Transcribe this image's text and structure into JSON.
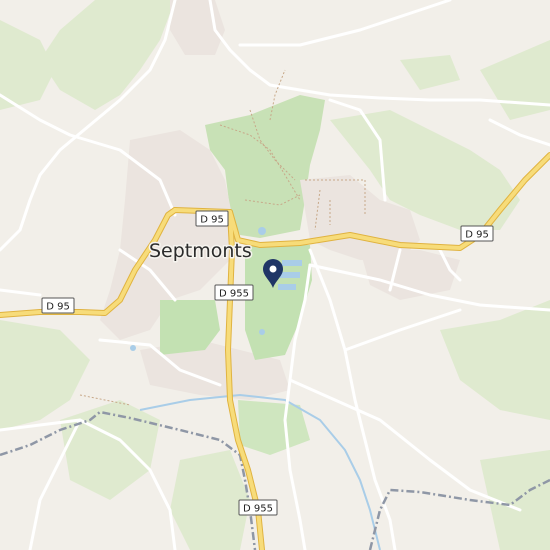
{
  "map": {
    "place_label": "Septmonts",
    "road_labels": [
      {
        "id": "d95-top",
        "text": "D 95"
      },
      {
        "id": "d95-right",
        "text": "D 95"
      },
      {
        "id": "d95-left",
        "text": "D 95"
      },
      {
        "id": "d955-center",
        "text": "D 955"
      },
      {
        "id": "d955-bottom",
        "text": "D 955"
      }
    ],
    "marker_icon": "location-pin-icon",
    "colors": {
      "background": "#f2efe9",
      "forest": "#d6e8cc",
      "park": "#c2e0b4",
      "settlement": "#e9e3de",
      "main_road": "#f5c542",
      "main_road_casing": "#e0b340",
      "minor_road": "#ffffff",
      "water": "#a9cde8",
      "boundary": "#8f97a6",
      "marker": "#1f3566"
    }
  }
}
